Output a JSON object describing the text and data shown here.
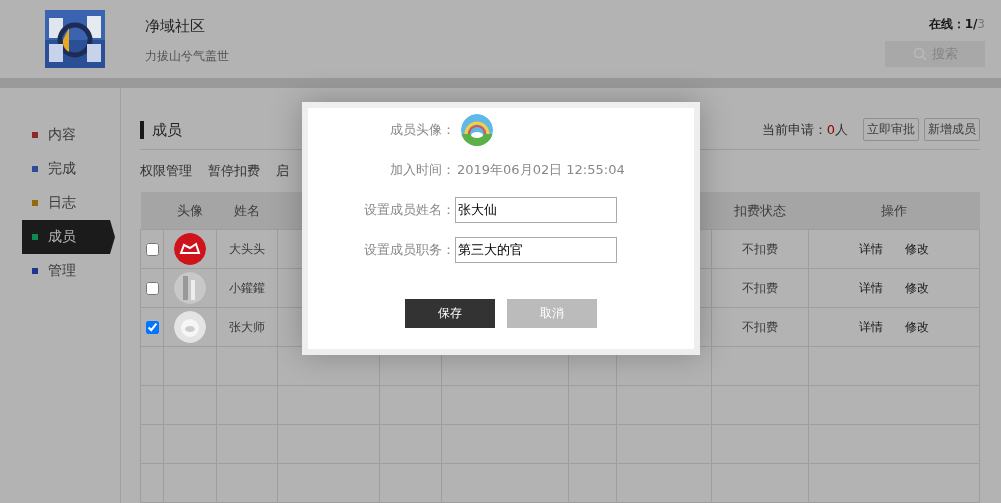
{
  "header": {
    "title": "净域社区",
    "subtitle": "力拔山兮气盖世",
    "online_label": "在线：",
    "online_count": "1/",
    "online_total": "3",
    "search_button": "搜索"
  },
  "sidebar": {
    "items": [
      {
        "label": "内容",
        "color": "#8a2a2a",
        "selected": false
      },
      {
        "label": "完成",
        "color": "#2f4a99",
        "selected": false
      },
      {
        "label": "日志",
        "color": "#936a0c",
        "selected": false
      },
      {
        "label": "成员",
        "color": "#0c8a4f",
        "selected": true
      },
      {
        "label": "管理",
        "color": "#1c3790",
        "selected": false
      }
    ]
  },
  "panel": {
    "title": "成员",
    "pending_label": "当前申请：",
    "pending_count": "0",
    "pending_unit": "人",
    "buttons": [
      "立即审批",
      "新增成员"
    ]
  },
  "toolbar": [
    "权限管理",
    "暂停扣费",
    "启"
  ],
  "table": {
    "columns": {
      "avatar": "头像",
      "name": "姓名",
      "fee_status": "扣费状态",
      "actions": "操作"
    },
    "rows": [
      {
        "checked": false,
        "name": "大头头",
        "fee_status": "不扣费",
        "actions": [
          "详情",
          "修改"
        ]
      },
      {
        "checked": false,
        "name": "小鑵鑵",
        "fee_status": "不扣费",
        "actions": [
          "详情",
          "修改"
        ]
      },
      {
        "checked": true,
        "name": "张大师",
        "fee_status": "不扣费",
        "actions": [
          "详情",
          "修改"
        ]
      }
    ]
  },
  "dialog": {
    "fields": [
      {
        "kind": "avatar",
        "label": "成员头像："
      },
      {
        "kind": "text",
        "label": "加入时间：",
        "value": "2019年06月02日 12:55:04"
      },
      {
        "kind": "input",
        "label": "设置成员姓名：",
        "value": "张大仙"
      },
      {
        "kind": "input",
        "label": "设置成员职务：",
        "value": "第三大的官"
      }
    ],
    "buttons": [
      {
        "kind": "primary",
        "label": "保存"
      },
      {
        "kind": "secondary",
        "label": "取消"
      }
    ]
  }
}
